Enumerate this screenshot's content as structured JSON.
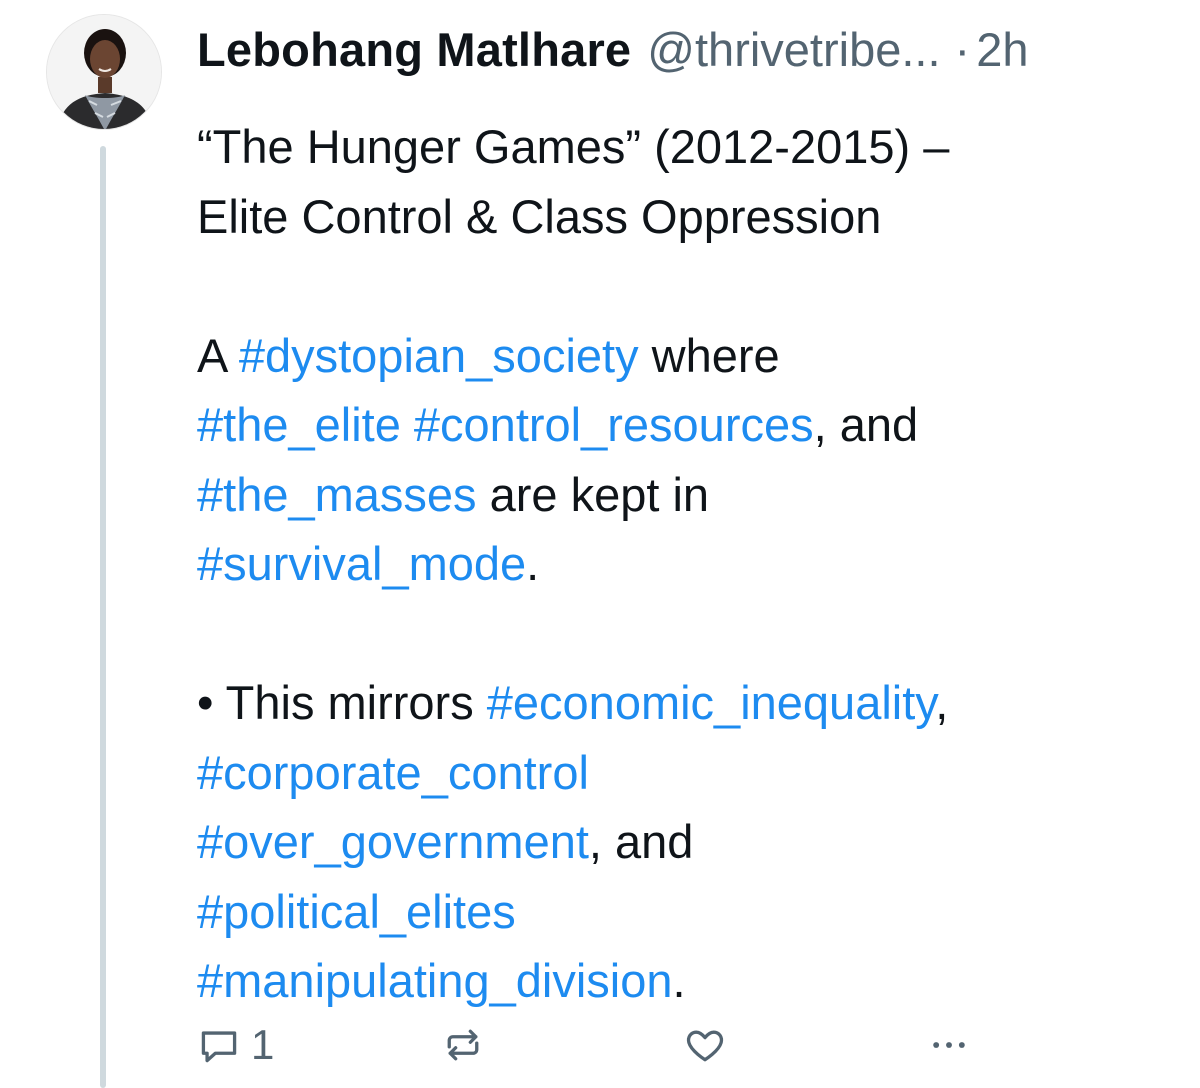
{
  "post": {
    "author": {
      "display_name": "Lebohang Matlhare",
      "handle": "@thrivetribe...",
      "separator": "·",
      "timestamp": "2h"
    },
    "text": {
      "title_line_1": "“The Hunger Games” (2012-2015) –",
      "title_line_2": "Elite Control & Class Oppression",
      "p1": {
        "w1": "A ",
        "h1": "#dystopian_society",
        "w2": " where",
        "h2": "#the_elite",
        "w3": " ",
        "h3": "#control_resources",
        "w4": ", and",
        "h4": "#the_masses",
        "w5": " are kept in",
        "h5": "#survival_mode",
        "w6": "."
      },
      "p2": {
        "bullet": "• This mirrors ",
        "h1": "#economic_inequality",
        "w1": ",",
        "h2": "#corporate_control",
        "h3": "#over_government",
        "w2": ", and",
        "h4": "#political_elites",
        "h5": "#manipulating_division",
        "w3": "."
      }
    },
    "actions": {
      "reply_count": "1",
      "icons": [
        "reply-icon",
        "repost-icon",
        "like-icon",
        "more-icon"
      ]
    },
    "colors": {
      "text": "#0f1419",
      "muted": "#536471",
      "link": "#1d8bf0",
      "thread_line": "#cfd9de"
    }
  }
}
